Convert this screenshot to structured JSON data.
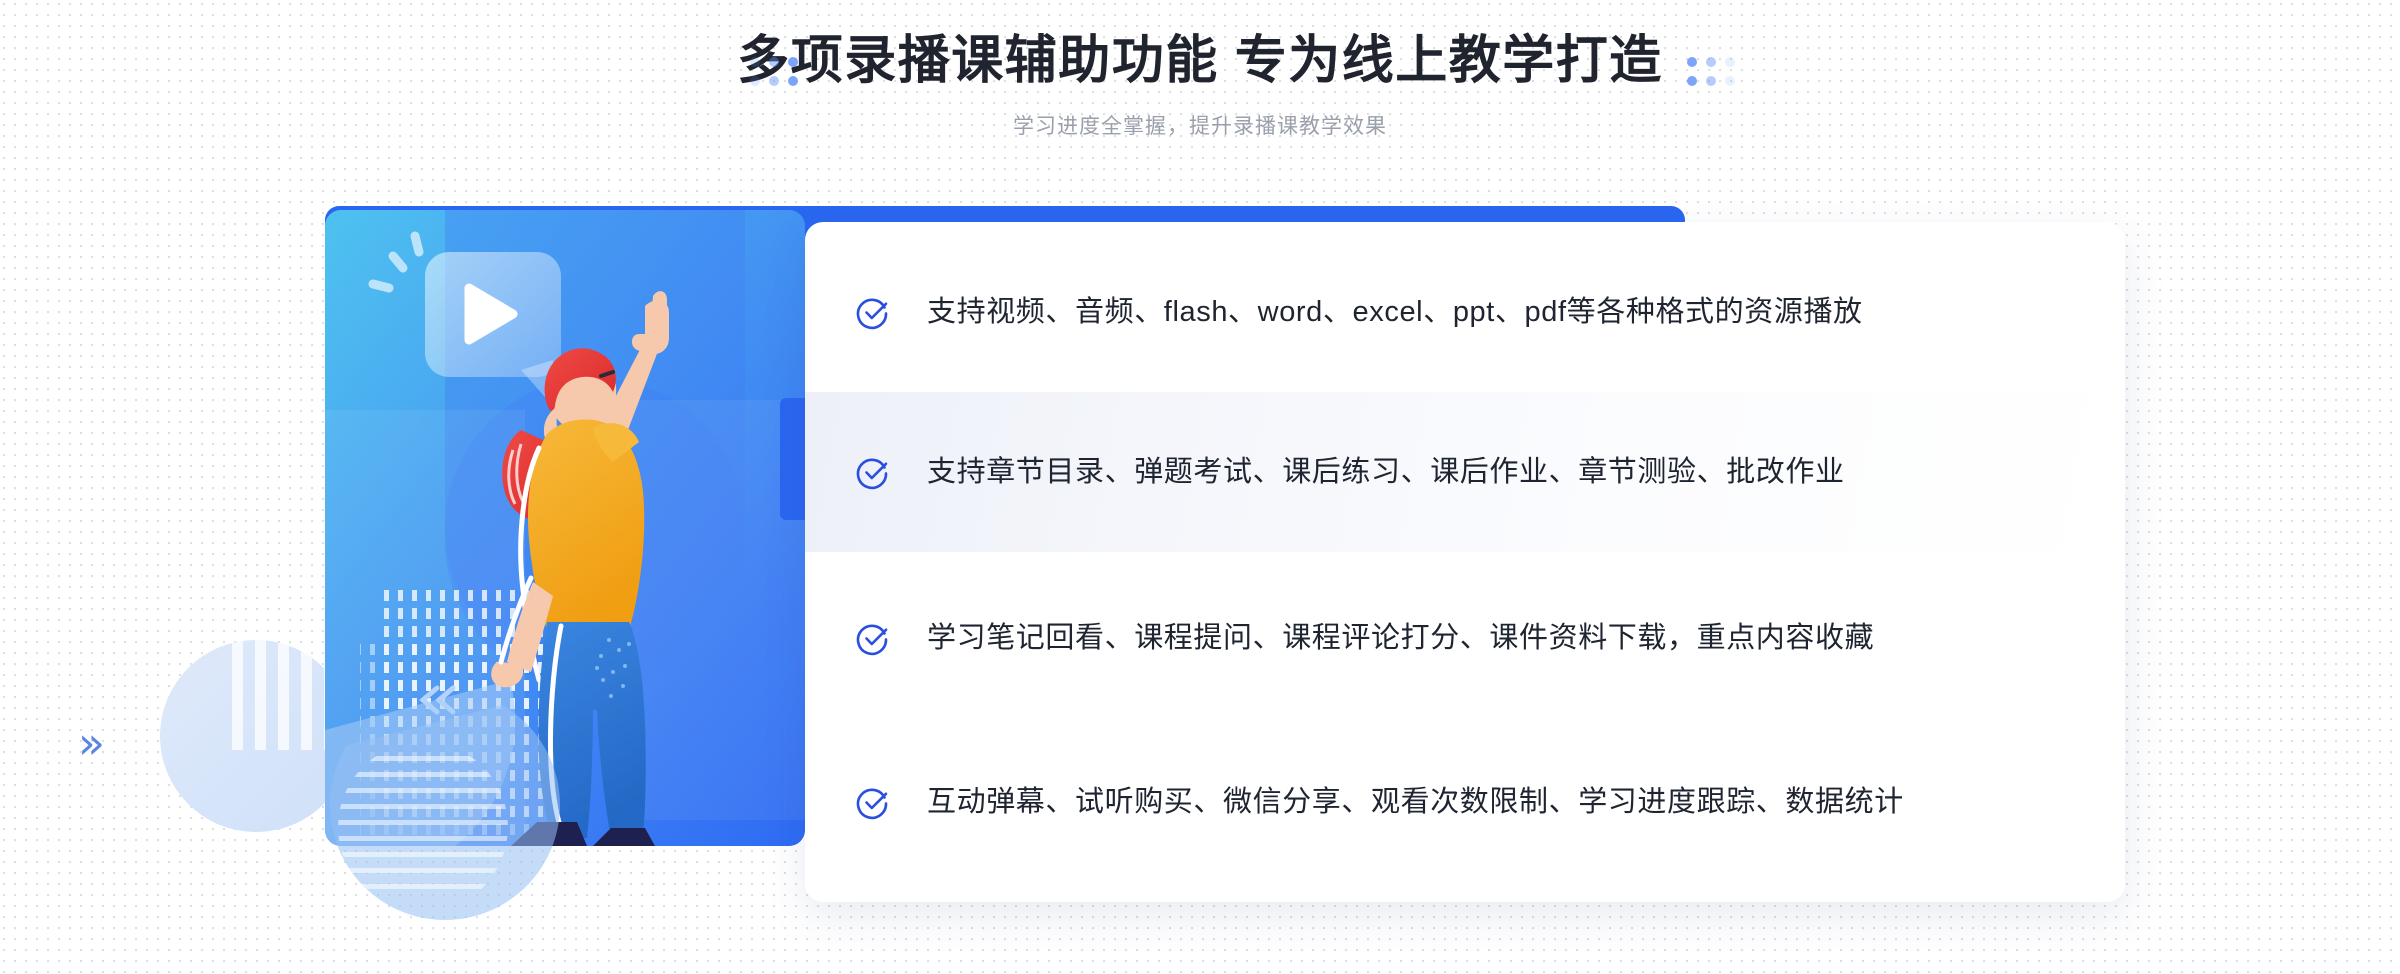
{
  "header": {
    "title": "多项录播课辅助功能 专为线上教学打造",
    "subtitle": "学习进度全掌握，提升录播课教学效果",
    "title_color": "#20242e",
    "subtitle_color": "#9aa0ab"
  },
  "decorations": {
    "left_dots_name": "dot-grid-decoration-left",
    "right_dots_name": "dot-grid-decoration-right",
    "chevron_right": "»",
    "chevron_left": "«",
    "accent_color": "#2a67f0",
    "panel_gradient_start": "#45bdf0",
    "panel_gradient_end": "#2f6cf3"
  },
  "illustration": {
    "alt": "pointing-woman-with-video-play-bubble",
    "shirt_color": "#f4a81f",
    "hair_color": "#e8393c",
    "pants_color": "#2e7bd6",
    "shoe_color": "#1e2150",
    "skin_color": "#f7c9ac",
    "play_icon": "play-triangle"
  },
  "features": {
    "check_color": "#2a4fe0",
    "items": [
      {
        "text": "支持视频、音频、flash、word、excel、ppt、pdf等各种格式的资源播放",
        "highlighted": false
      },
      {
        "text": "支持章节目录、弹题考试、课后练习、课后作业、章节测验、批改作业",
        "highlighted": true
      },
      {
        "text": "学习笔记回看、课程提问、课程评论打分、课件资料下载，重点内容收藏",
        "highlighted": false
      },
      {
        "text": "互动弹幕、试听购买、微信分享、观看次数限制、学习进度跟踪、数据统计",
        "highlighted": false
      }
    ]
  }
}
